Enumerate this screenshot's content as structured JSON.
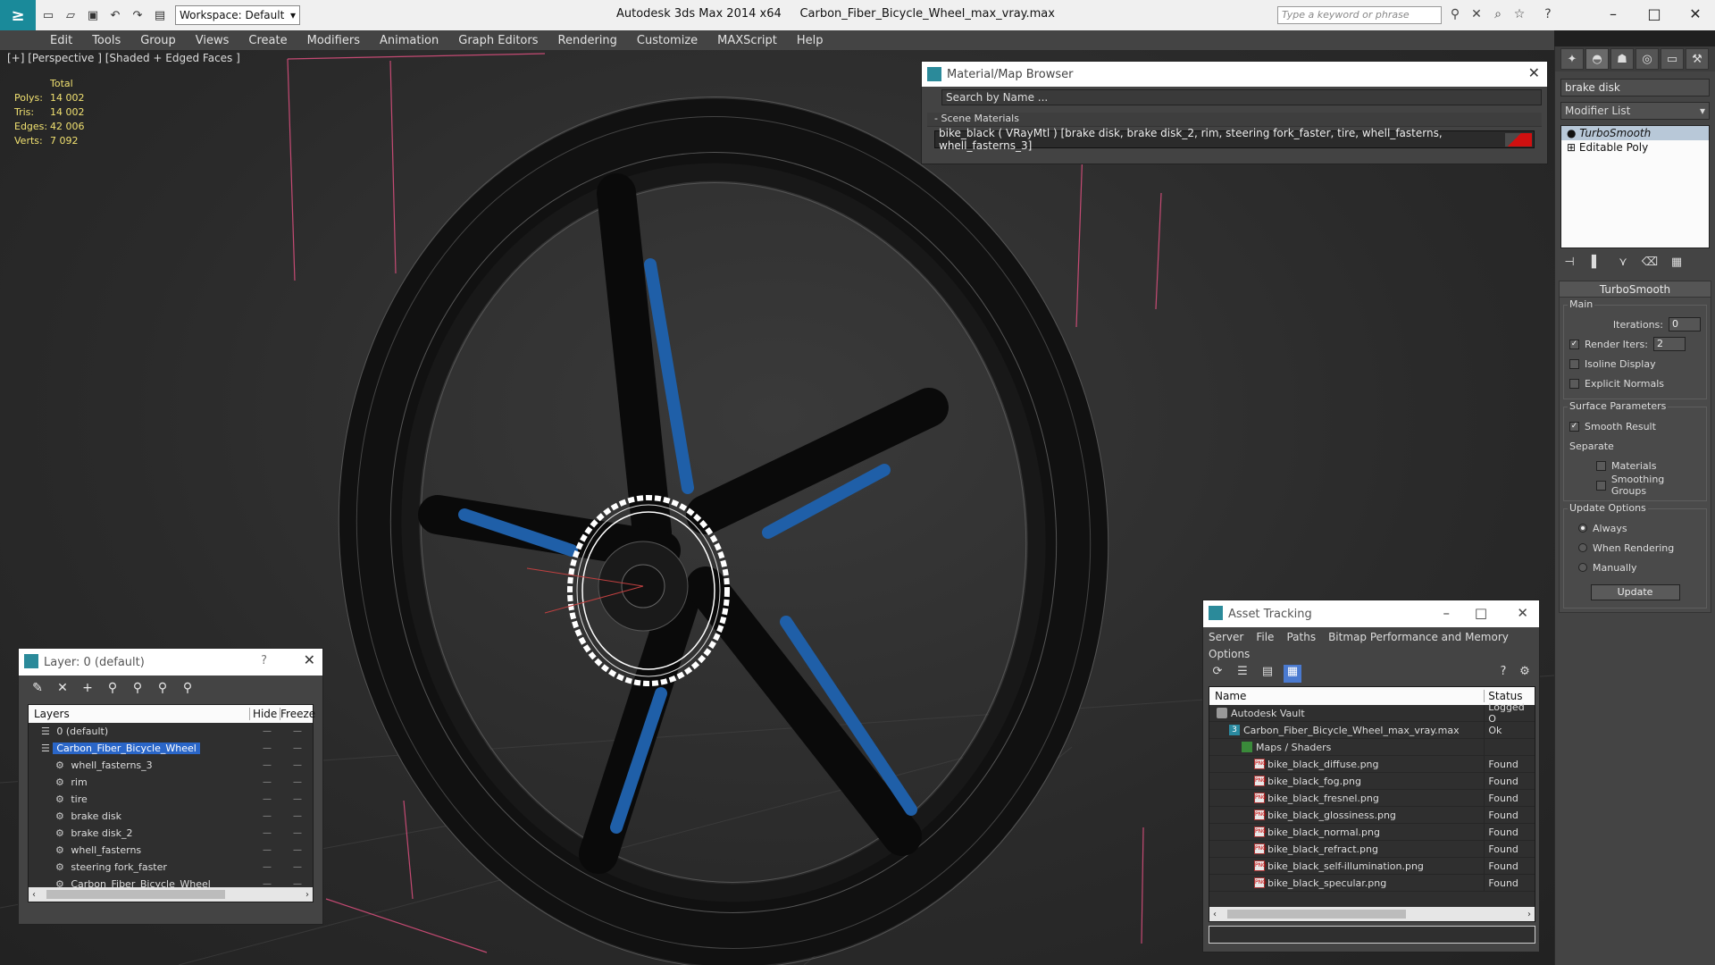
{
  "titlebar": {
    "app_title": "Autodesk 3ds Max  2014 x64",
    "file_title": "Carbon_Fiber_Bicycle_Wheel_max_vray.max",
    "workspace": "Workspace: Default",
    "search_placeholder": "Type a keyword or phrase"
  },
  "menu": [
    "Edit",
    "Tools",
    "Group",
    "Views",
    "Create",
    "Modifiers",
    "Animation",
    "Graph Editors",
    "Rendering",
    "Customize",
    "MAXScript",
    "Help"
  ],
  "viewport": {
    "label": "[+] [Perspective ] [Shaded + Edged Faces ]",
    "stats": {
      "header": "Total",
      "rows": [
        {
          "k": "Polys:",
          "v": "14 002"
        },
        {
          "k": "Tris:",
          "v": "14 002"
        },
        {
          "k": "Edges:",
          "v": "42 006"
        },
        {
          "k": "Verts:",
          "v": "7 092"
        }
      ]
    }
  },
  "command_panel": {
    "object_name": "brake disk",
    "modifier_list": "Modifier List",
    "stack": [
      "TurboSmooth",
      "Editable Poly"
    ],
    "rollout_title": "TurboSmooth",
    "main": {
      "title": "Main",
      "iterations_label": "Iterations:",
      "iterations": "0",
      "render_iters_label": "Render Iters:",
      "render_iters": "2",
      "isoline": "Isoline Display",
      "explicit": "Explicit Normals"
    },
    "surface": {
      "title": "Surface Parameters",
      "smooth_result": "Smooth Result",
      "separate": "Separate",
      "materials": "Materials",
      "smoothing_groups": "Smoothing Groups"
    },
    "update": {
      "title": "Update Options",
      "always": "Always",
      "when_rendering": "When Rendering",
      "manually": "Manually",
      "button": "Update"
    }
  },
  "material_browser": {
    "title": "Material/Map Browser",
    "search_placeholder": "Search by Name ...",
    "section": "Scene Materials",
    "entry": "bike_black  ( VRayMtl )  [brake disk, brake disk_2, rim, steering fork_faster, tire, whell_fasterns, whell_fasterns_3]"
  },
  "layer_dialog": {
    "title": "Layer: 0 (default)",
    "help": "?",
    "columns": {
      "layers": "Layers",
      "hide": "Hide",
      "freeze": "Freeze"
    },
    "rows": [
      {
        "name": "0 (default)",
        "indent": 1
      },
      {
        "name": "Carbon_Fiber_Bicycle_Wheel",
        "indent": 1
      },
      {
        "name": "whell_fasterns_3",
        "indent": 2
      },
      {
        "name": "rim",
        "indent": 2
      },
      {
        "name": "tire",
        "indent": 2
      },
      {
        "name": "brake disk",
        "indent": 2
      },
      {
        "name": "brake disk_2",
        "indent": 2
      },
      {
        "name": "whell_fasterns",
        "indent": 2
      },
      {
        "name": "steering fork_faster",
        "indent": 2
      },
      {
        "name": "Carbon_Fiber_Bicycle_Wheel",
        "indent": 2
      }
    ]
  },
  "asset_dialog": {
    "title": "Asset Tracking",
    "menu": [
      "Server",
      "File",
      "Paths",
      "Bitmap Performance and Memory",
      "Options"
    ],
    "columns": {
      "name": "Name",
      "status": "Status"
    },
    "rows": [
      {
        "name": "Autodesk Vault",
        "status": "Logged O",
        "type": "vault",
        "indent": 1
      },
      {
        "name": "Carbon_Fiber_Bicycle_Wheel_max_vray.max",
        "status": "Ok",
        "type": "max",
        "indent": 2
      },
      {
        "name": "Maps / Shaders",
        "status": "",
        "type": "map",
        "indent": 3
      },
      {
        "name": "bike_black_diffuse.png",
        "status": "Found",
        "type": "png",
        "indent": 4
      },
      {
        "name": "bike_black_fog.png",
        "status": "Found",
        "type": "png",
        "indent": 4
      },
      {
        "name": "bike_black_fresnel.png",
        "status": "Found",
        "type": "png",
        "indent": 4
      },
      {
        "name": "bike_black_glossiness.png",
        "status": "Found",
        "type": "png",
        "indent": 4
      },
      {
        "name": "bike_black_normal.png",
        "status": "Found",
        "type": "png",
        "indent": 4
      },
      {
        "name": "bike_black_refract.png",
        "status": "Found",
        "type": "png",
        "indent": 4
      },
      {
        "name": "bike_black_self-illumination.png",
        "status": "Found",
        "type": "png",
        "indent": 4
      },
      {
        "name": "bike_black_specular.png",
        "status": "Found",
        "type": "png",
        "indent": 4
      }
    ]
  }
}
